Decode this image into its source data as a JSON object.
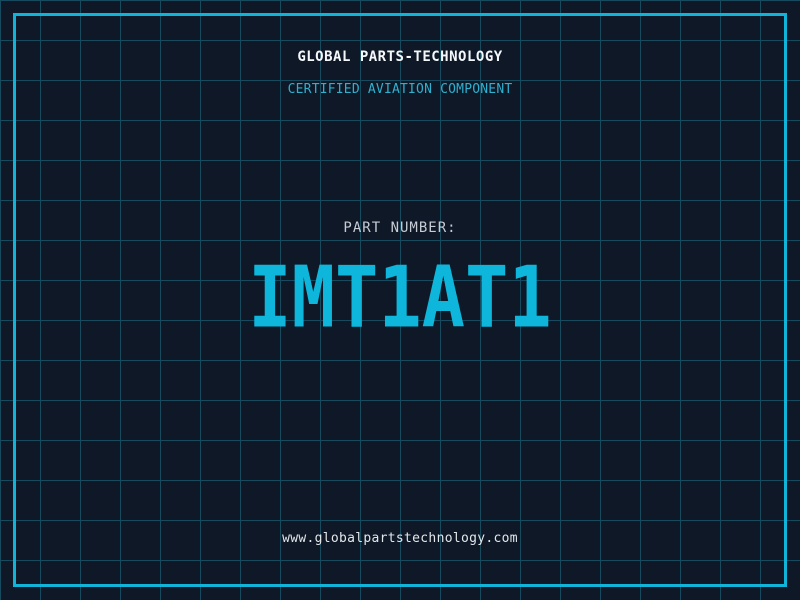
{
  "colors": {
    "background": "#0e1827",
    "grid": "#164a5f",
    "frame": "#0fb4d8",
    "heading": "#f5f7fa",
    "tagline": "#2fb0cf",
    "label": "#c7ccd4",
    "part-number": "#0db6da",
    "footer-text": "#e4e7ea"
  },
  "header": {
    "company": "GLOBAL PARTS-TECHNOLOGY",
    "tagline": "CERTIFIED AVIATION COMPONENT"
  },
  "part": {
    "label": "PART NUMBER:",
    "number": "IMT1AT1"
  },
  "footer": {
    "website": "www.globalpartstechnology.com"
  }
}
